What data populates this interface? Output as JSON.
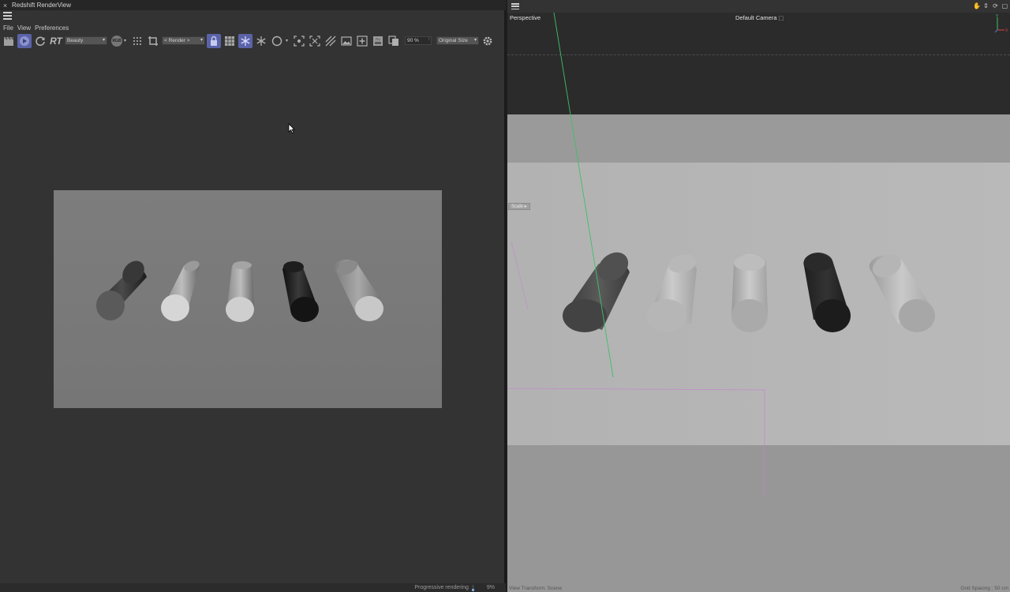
{
  "renderview": {
    "title": "Redshift RenderView",
    "close_glyph": "×",
    "menu": [
      "File",
      "View",
      "Preferences"
    ],
    "toolbar": {
      "rt_label": "RT",
      "aov_select": "Beauty",
      "rgb_label": "RGB",
      "render_select": "< Render >",
      "zoom_value": "90 %",
      "size_select": "Original Size"
    },
    "status": {
      "label": "Progressive rendering",
      "progress_fraction": 0.3,
      "percent": "9%"
    },
    "cylinders": [
      {
        "tone": "dark",
        "tilt": "left"
      },
      {
        "tone": "light",
        "tilt": "left"
      },
      {
        "tone": "light",
        "tilt": "upright"
      },
      {
        "tone": "black",
        "tilt": "upright"
      },
      {
        "tone": "mid",
        "tilt": "right"
      }
    ]
  },
  "viewport": {
    "view_name": "Perspective",
    "camera": "Default Camera",
    "camera_glyph": "⬚",
    "scale_chip": "Scale ▸",
    "status_left": "View Transform: Scene",
    "status_right": "Grid Spacing : 50 cm",
    "nav_icons": [
      "hand-icon",
      "move-icon",
      "rotate-icon",
      "maximize-icon"
    ],
    "nav_glyphs": [
      "✋",
      "⇕",
      "⟳",
      "▢"
    ],
    "axis_labels": {
      "y": "Y",
      "x": "X"
    }
  },
  "colors": {
    "accent": "#5b63a8",
    "axis_y": "#3fbf6a",
    "axis_x": "#d94040",
    "selection_outline": "#c77fd0"
  }
}
